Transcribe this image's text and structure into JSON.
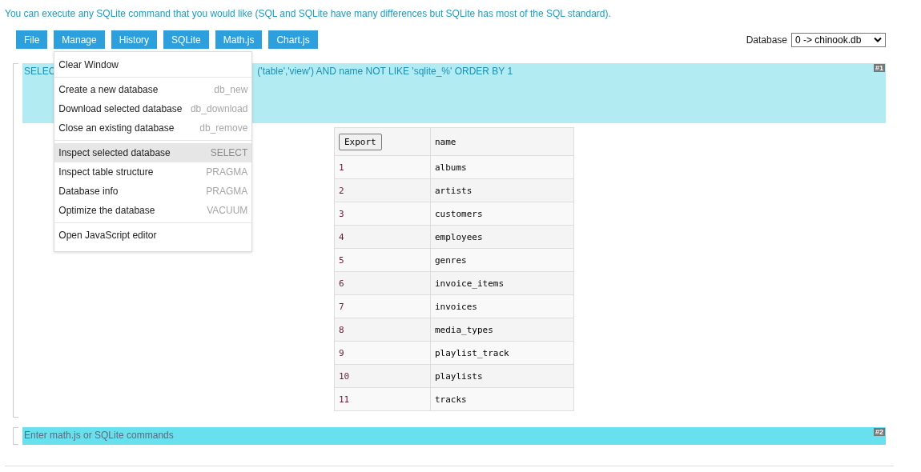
{
  "intro": "You can execute any SQLite command that you would like (SQL and SQLite have many differences but SQLite has most of the SQL standard).",
  "toolbar": {
    "buttons": [
      {
        "label": "File"
      },
      {
        "label": "Manage",
        "menu": {
          "groups": [
            [
              {
                "label": "Clear Window",
                "highlighted": false
              }
            ],
            [
              {
                "label": "Create a new database",
                "hint": "db_new",
                "highlighted": false
              },
              {
                "label": "Download selected database",
                "hint": "db_download",
                "highlighted": false
              },
              {
                "label": "Close an existing database",
                "hint": "db_remove",
                "highlighted": false
              }
            ],
            [
              {
                "label": "Inspect selected database",
                "hint": "SELECT",
                "highlighted": true
              },
              {
                "label": "Inspect table structure",
                "hint": "PRAGMA",
                "highlighted": false
              },
              {
                "label": "Database info",
                "hint": "PRAGMA",
                "highlighted": false
              },
              {
                "label": "Optimize the database",
                "hint": "VACUUM",
                "highlighted": false
              }
            ],
            [
              {
                "label": "Open JavaScript editor",
                "highlighted": false
              }
            ]
          ]
        }
      },
      {
        "label": "History"
      },
      {
        "label": "SQLite"
      },
      {
        "label": "Math.js"
      },
      {
        "label": "Chart.js"
      }
    ],
    "database_label": "Database",
    "database_value": "0 -> chinook.db"
  },
  "cells": [
    {
      "badge": "#1",
      "query_start": "SELEC",
      "query_end": "('table','view') AND name NOT LIKE 'sqlite_%' ORDER BY 1",
      "result": {
        "columns": [
          {
            "kind": "button",
            "label": "Export"
          },
          {
            "kind": "text",
            "label": "name"
          }
        ],
        "rows": [
          [
            "1",
            "albums"
          ],
          [
            "2",
            "artists"
          ],
          [
            "3",
            "customers"
          ],
          [
            "4",
            "employees"
          ],
          [
            "5",
            "genres"
          ],
          [
            "6",
            "invoice_items"
          ],
          [
            "7",
            "invoices"
          ],
          [
            "8",
            "media_types"
          ],
          [
            "9",
            "playlist_track"
          ],
          [
            "10",
            "playlists"
          ],
          [
            "11",
            "tracks"
          ]
        ]
      }
    },
    {
      "badge": "#2",
      "placeholder": "Enter math.js or SQLite commands"
    }
  ]
}
